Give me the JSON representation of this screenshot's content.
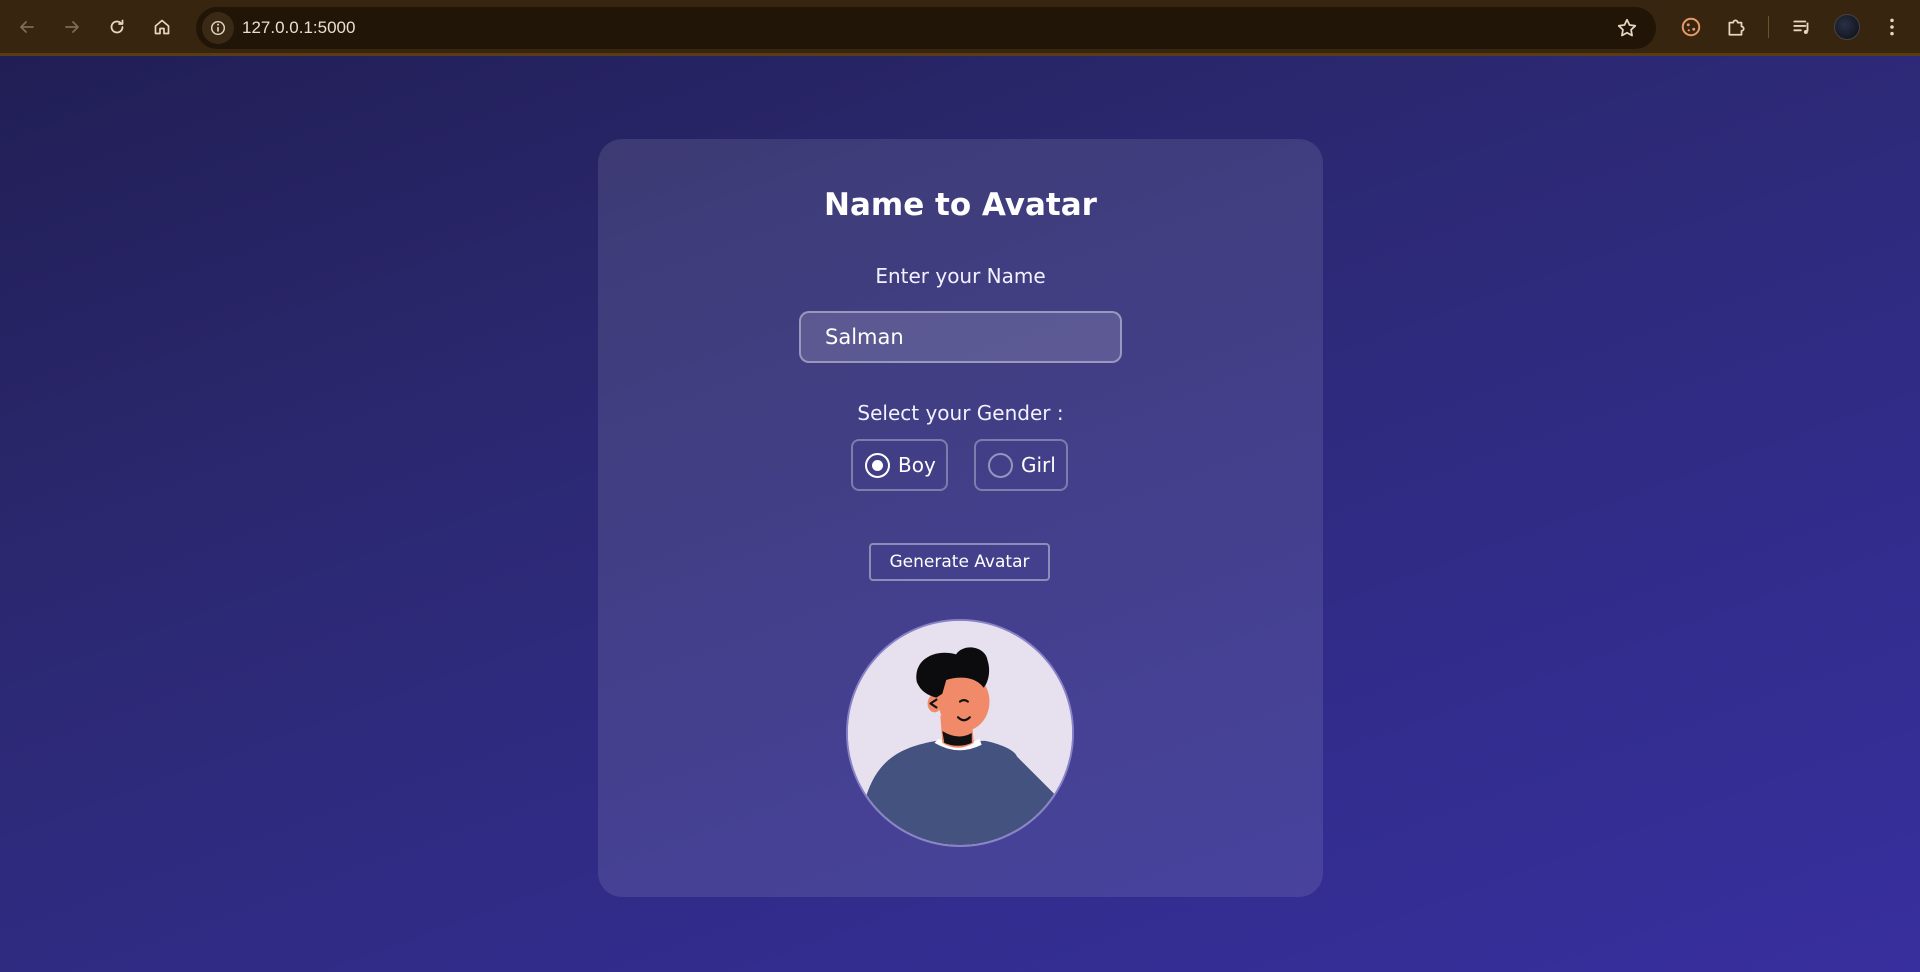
{
  "browser": {
    "url": "127.0.0.1:5000",
    "icons": [
      "back-arrow-icon",
      "forward-arrow-icon",
      "reload-icon",
      "home-icon",
      "site-info-icon",
      "bookmark-star-icon",
      "extension-cookie-icon",
      "extensions-puzzle-icon",
      "media-queue-icon",
      "profile-avatar",
      "more-menu-icon"
    ]
  },
  "app": {
    "title": "Name to Avatar",
    "name_label": "Enter your Name",
    "name_value": "Salman",
    "gender_label": "Select your Gender :",
    "gender_options": [
      {
        "label": "Boy",
        "checked": true
      },
      {
        "label": "Girl",
        "checked": false
      }
    ],
    "generate_button": "Generate Avatar"
  },
  "colors": {
    "background_gradient": [
      "#201d52",
      "#382f9e"
    ],
    "chrome_bar": "#37250f",
    "avatar_bg": "#e7e1ef",
    "avatar_shirt": "#43527e",
    "avatar_skin": "#f08a68",
    "avatar_hair": "#0c0c0e"
  }
}
